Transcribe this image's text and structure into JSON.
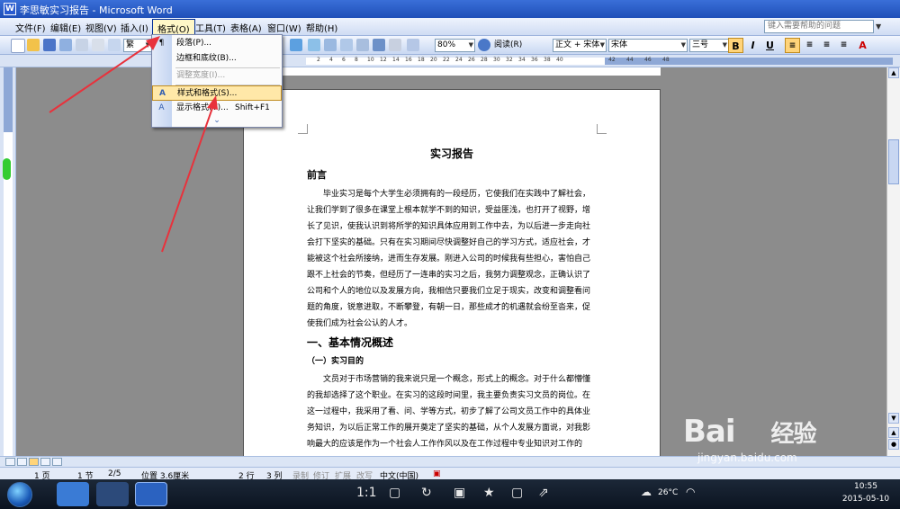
{
  "window": {
    "title": "李思敏实习报告 - Microsoft Word",
    "app_icon": "W"
  },
  "menubar": {
    "items": [
      "文件(F)",
      "编辑(E)",
      "视图(V)",
      "插入(I)",
      "格式(O)",
      "工具(T)",
      "表格(A)",
      "窗口(W)",
      "帮助(H)"
    ],
    "help_placeholder": "键入需要帮助的问题"
  },
  "toolbar": {
    "style_combo": "繁",
    "zoom": "80%",
    "read_label": "阅读(R)",
    "style_name": "正文 + 宋体",
    "font_name": "宋体",
    "font_size": "三号",
    "bold": "B",
    "italic": "I",
    "underline": "U",
    "font_color_label": "A"
  },
  "format_menu": {
    "items": [
      {
        "label": "段落(P)...",
        "icon": "paragraph-icon",
        "disabled": false
      },
      {
        "label": "边框和底纹(B)...",
        "icon": "",
        "disabled": false
      },
      {
        "label": "调整宽度(I)...",
        "icon": "",
        "disabled": true
      },
      {
        "label": "样式和格式(S)...",
        "icon": "styles-icon",
        "disabled": false,
        "highlighted": true
      },
      {
        "label": "显示格式(V)...",
        "shortcut": "Shift+F1",
        "icon": "reveal-formatting-icon",
        "disabled": false
      }
    ],
    "expand": "expand-menu-icon"
  },
  "ruler": {
    "numbers": [
      "2",
      "4",
      "6",
      "8",
      "10",
      "12",
      "14",
      "16",
      "18",
      "20",
      "22",
      "24",
      "26",
      "28",
      "30",
      "32",
      "34",
      "36",
      "38",
      "40",
      "42",
      "44",
      "46",
      "48"
    ]
  },
  "document": {
    "title": "实习报告",
    "heading_preface": "前言",
    "preface_lines": [
      "毕业实习是每个大学生必须拥有的一段经历，它使我们在实践中了解社会，",
      "让我们学到了很多在课堂上根本就学不到的知识，受益匪浅，也打开了视野，增",
      "长了见识，使我认识到将所学的知识具体应用到工作中去，为以后进一步走向社",
      "会打下坚实的基础。只有在实习期间尽快调整好自己的学习方式，适应社会，才",
      "能被这个社会所接纳，进而生存发展。刚进入公司的时候我有些担心，害怕自己",
      "跟不上社会的节奏，但经历了一连串的实习之后，我努力调整观念，正确认识了",
      "公司和个人的地位以及发展方向，我相信只要我们立足于现实，改变和调整看问",
      "题的角度，锐意进取，不断攀登，有朝一日，那些成才的机遇就会纷至沓来，促",
      "使我们成为社会公认的人才。"
    ],
    "heading_1": "一、基本情况概述",
    "heading_1_1": "（一）实习目的",
    "purpose_lines": [
      "文员对于市场营销的我来说只是一个概念，形式上的概念。对于什么都懵懂",
      "的我却选择了这个职业。在实习的这段时间里，我主要负责实习文员的岗位。在",
      "这一过程中，我采用了看、问、学等方式，初步了解了公司文员工作中的具体业",
      "务知识，为以后正常工作的展开奠定了坚实的基础，从个人发展方面说，对我影",
      "响最大的应该是作为一个社会人工作作风以及在工作过程中专业知识对工作的"
    ]
  },
  "statusbar": {
    "page": "1 页",
    "section": "1 节",
    "page_of": "2/5",
    "position": "位置 3.6厘米",
    "line": "2 行",
    "column": "3 列",
    "modes": [
      "录制",
      "修订",
      "扩展",
      "改写"
    ],
    "language": "中文(中国)"
  },
  "taskbar": {
    "controls": [
      "1:1"
    ],
    "temperature": "26°C",
    "time": "10:55",
    "date": "2015-05-10"
  },
  "watermark": {
    "brand": "Bai",
    "brand_cn": "经验",
    "url": "jingyan.baidu.com"
  },
  "colors": {
    "titlebar": "#1f4fb8",
    "highlight": "#ffe8a8",
    "arrow": "#e8323c"
  }
}
